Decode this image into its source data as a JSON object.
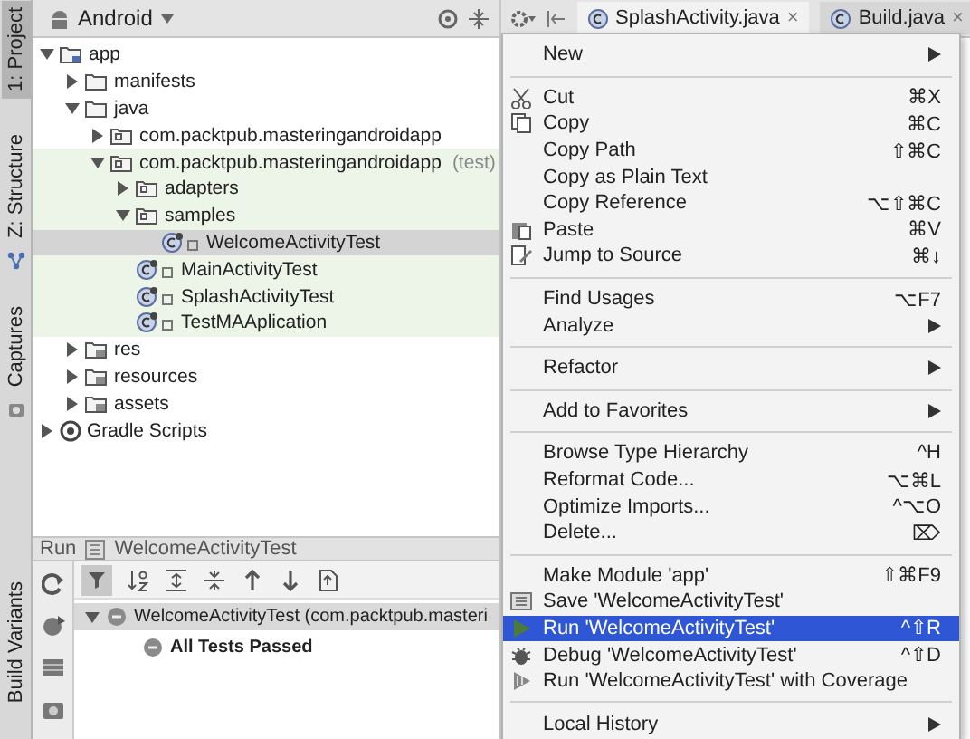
{
  "tool_windows_top": [
    {
      "label": "1: Project",
      "selected": true
    },
    {
      "label": "Z: Structure",
      "selected": false
    },
    {
      "label": "Captures",
      "selected": false
    }
  ],
  "tool_windows_bottom": [
    {
      "label": "Build Variants",
      "selected": false
    }
  ],
  "project_panel": {
    "view": "Android",
    "tree": [
      {
        "label": "app",
        "kind": "module",
        "expanded": true,
        "selected": false,
        "test": false,
        "children": [
          {
            "label": "manifests",
            "kind": "folder",
            "expanded": false,
            "selected": false,
            "test": false
          },
          {
            "label": "java",
            "kind": "folder",
            "expanded": true,
            "selected": false,
            "test": false,
            "children": [
              {
                "label": "com.packtpub.masteringandroidapp",
                "kind": "package",
                "expanded": false,
                "selected": false,
                "test": false
              },
              {
                "label": "com.packtpub.masteringandroidapp",
                "suffix": "(test)",
                "kind": "package",
                "expanded": true,
                "selected": false,
                "test": true,
                "children": [
                  {
                    "label": "adapters",
                    "kind": "package",
                    "expanded": false,
                    "selected": false,
                    "test": true
                  },
                  {
                    "label": "samples",
                    "kind": "package",
                    "expanded": true,
                    "selected": false,
                    "test": true,
                    "children": [
                      {
                        "label": "WelcomeActivityTest",
                        "kind": "class",
                        "selected": true,
                        "test": true
                      }
                    ]
                  },
                  {
                    "label": "MainActivityTest",
                    "kind": "class",
                    "selected": false,
                    "test": true
                  },
                  {
                    "label": "SplashActivityTest",
                    "kind": "class",
                    "selected": false,
                    "test": true
                  },
                  {
                    "label": "TestMAAplication",
                    "kind": "class",
                    "selected": false,
                    "test": true
                  }
                ]
              }
            ]
          },
          {
            "label": "res",
            "kind": "resfolder",
            "expanded": false,
            "selected": false,
            "test": false
          },
          {
            "label": "resources",
            "kind": "resfolder",
            "expanded": false,
            "selected": false,
            "test": false
          },
          {
            "label": "assets",
            "kind": "resfolder",
            "expanded": false,
            "selected": false,
            "test": false
          }
        ]
      },
      {
        "label": "Gradle Scripts",
        "kind": "gradle",
        "expanded": false,
        "selected": false,
        "test": false
      }
    ]
  },
  "editor_tabs": [
    {
      "label": "SplashActivity.java",
      "selected": true,
      "close": "×"
    },
    {
      "label": "Build.java",
      "selected": false,
      "close": "×"
    }
  ],
  "context_menu": {
    "items": [
      {
        "kind": "item",
        "label": "New",
        "submenu": true,
        "selected": false
      },
      {
        "kind": "separator"
      },
      {
        "kind": "item",
        "label": "Cut",
        "shortcut": "⌘X",
        "selected": false
      },
      {
        "kind": "item",
        "label": "Copy",
        "shortcut": "⌘C",
        "selected": false
      },
      {
        "kind": "item",
        "label": "Copy Path",
        "shortcut": "⇧⌘C",
        "selected": false
      },
      {
        "kind": "item",
        "label": "Copy as Plain Text",
        "selected": false
      },
      {
        "kind": "item",
        "label": "Copy Reference",
        "shortcut": "⌥⇧⌘C",
        "selected": false
      },
      {
        "kind": "item",
        "label": "Paste",
        "shortcut": "⌘V",
        "selected": false
      },
      {
        "kind": "item",
        "label": "Jump to Source",
        "shortcut": "⌘↓",
        "selected": false
      },
      {
        "kind": "separator"
      },
      {
        "kind": "item",
        "label": "Find Usages",
        "shortcut": "⌥F7",
        "selected": false
      },
      {
        "kind": "item",
        "label": "Analyze",
        "submenu": true,
        "selected": false
      },
      {
        "kind": "separator"
      },
      {
        "kind": "item",
        "label": "Refactor",
        "submenu": true,
        "selected": false
      },
      {
        "kind": "separator"
      },
      {
        "kind": "item",
        "label": "Add to Favorites",
        "submenu": true,
        "selected": false
      },
      {
        "kind": "separator"
      },
      {
        "kind": "item",
        "label": "Browse Type Hierarchy",
        "shortcut": "^H",
        "selected": false
      },
      {
        "kind": "item",
        "label": "Reformat Code...",
        "shortcut": "⌥⌘L",
        "selected": false
      },
      {
        "kind": "item",
        "label": "Optimize Imports...",
        "shortcut": "^⌥O",
        "selected": false
      },
      {
        "kind": "item",
        "label": "Delete...",
        "shortcut": "⌦",
        "selected": false
      },
      {
        "kind": "separator"
      },
      {
        "kind": "item",
        "label": "Make Module 'app'",
        "shortcut": "⇧⌘F9",
        "selected": false
      },
      {
        "kind": "item",
        "label": "Save 'WelcomeActivityTest'",
        "selected": false
      },
      {
        "kind": "item",
        "label": "Run 'WelcomeActivityTest'",
        "shortcut": "^⇧R",
        "selected": true
      },
      {
        "kind": "item",
        "label": "Debug 'WelcomeActivityTest'",
        "shortcut": "^⇧D",
        "selected": false
      },
      {
        "kind": "item",
        "label": "Run 'WelcomeActivityTest' with Coverage",
        "selected": false
      },
      {
        "kind": "separator"
      },
      {
        "kind": "item",
        "label": "Local History",
        "submenu": true,
        "selected": false
      }
    ]
  },
  "run_panel": {
    "title": "Run",
    "config": "WelcomeActivityTest",
    "results": [
      {
        "label": "WelcomeActivityTest (com.packtpub.masteri",
        "expanded": true,
        "selected": true,
        "children": [
          {
            "label": "All Tests Passed",
            "selected": false
          }
        ]
      }
    ]
  }
}
